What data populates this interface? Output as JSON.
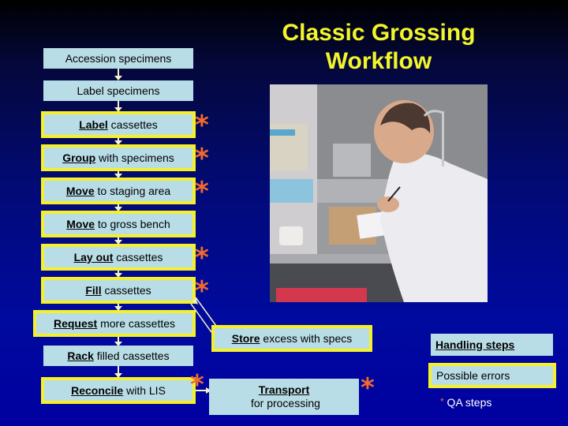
{
  "title": "Classic Grossing Workflow",
  "photo": {
    "alt": "Lab technician in white coat writing on a form at a grossing bench beside cassette tray"
  },
  "steps": [
    {
      "bold": "",
      "text": "Accession specimens",
      "error": false,
      "qa": false
    },
    {
      "bold": "",
      "text": "Label specimens",
      "error": false,
      "qa": false
    },
    {
      "bold": "Label",
      "text": " cassettes",
      "error": true,
      "qa": true
    },
    {
      "bold": "Group",
      "text": " with specimens",
      "error": true,
      "qa": true
    },
    {
      "bold": "Move",
      "text": " to staging area",
      "error": true,
      "qa": true
    },
    {
      "bold": "Move",
      "text": " to gross bench",
      "error": true,
      "qa": false
    },
    {
      "bold": "Lay out",
      "text": " cassettes",
      "error": true,
      "qa": true
    },
    {
      "bold": "Fill",
      "text": " cassettes",
      "error": true,
      "qa": true
    },
    {
      "bold": "Request",
      "text": " more cassettes",
      "error": true,
      "qa": false
    },
    {
      "bold": "Rack",
      "text": " filled cassettes",
      "error": false,
      "qa": false
    },
    {
      "bold": "Reconcile",
      "text": " with LIS",
      "error": true,
      "qa": true
    }
  ],
  "side_steps": {
    "store": {
      "bold": "Store",
      "text": " excess with specs"
    },
    "transport": {
      "bold": "Transport",
      "text": " for processing"
    }
  },
  "legend": {
    "handling": "Handling steps",
    "errors": "Possible errors",
    "qa_star": "*",
    "qa": " QA steps"
  },
  "star": "*",
  "colors": {
    "box": "#b9dde6",
    "error_border": "#f5f02a",
    "star": "#f26a2e",
    "title": "#f2f52a"
  }
}
